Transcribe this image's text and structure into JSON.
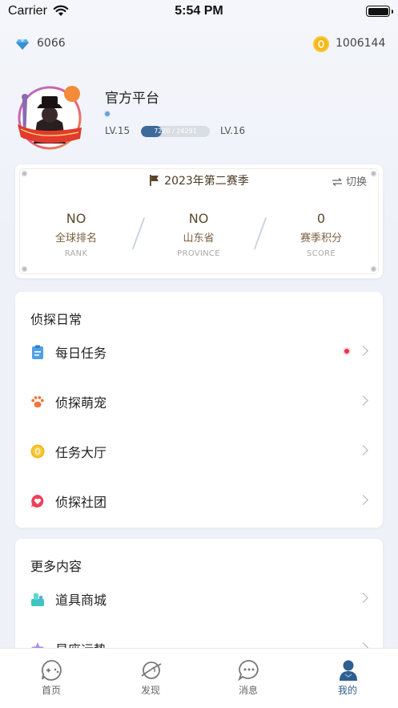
{
  "status_bar": {
    "carrier": "Carrier",
    "time": "5:54 PM"
  },
  "currency": {
    "gems": "6066",
    "coins": "1006144"
  },
  "profile": {
    "nickname": "官方平台",
    "level_current": "LV.15",
    "level_next": "LV.16",
    "xp_text": "7220 / 24291",
    "xp_progress": 0.2972
  },
  "season": {
    "title": "2023年第二赛季",
    "switch_label": "切换",
    "stats": [
      {
        "value": "NO",
        "label": "全球排名",
        "label_en": "RANK"
      },
      {
        "value": "NO",
        "label": "山东省",
        "label_en": "PROVINCE"
      },
      {
        "value": "0",
        "label": "赛季积分",
        "label_en": "SCORE"
      }
    ]
  },
  "daily_section": {
    "title": "侦探日常",
    "items": [
      {
        "label": "每日任务",
        "icon": "clipboard-icon",
        "badge": true
      },
      {
        "label": "侦探萌宠",
        "icon": "paw-icon",
        "badge": false
      },
      {
        "label": "任务大厅",
        "icon": "coin-icon",
        "badge": false
      },
      {
        "label": "侦探社团",
        "icon": "heart-chat-icon",
        "badge": false
      }
    ]
  },
  "more_section": {
    "title": "更多内容",
    "items": [
      {
        "label": "道具商城",
        "icon": "shop-icon"
      },
      {
        "label": "星座运势",
        "icon": "star-icon"
      }
    ]
  },
  "tabbar": {
    "tabs": [
      {
        "label": "首页",
        "icon": "game-controller-icon",
        "active": false
      },
      {
        "label": "发现",
        "icon": "planet-icon",
        "active": false
      },
      {
        "label": "消息",
        "icon": "chat-bubble-icon",
        "active": false
      },
      {
        "label": "我的",
        "icon": "person-icon",
        "active": true
      }
    ]
  },
  "colors": {
    "accent": "#2e5e8f",
    "season_text": "#5c4a2e",
    "badge": "#e8334a"
  }
}
